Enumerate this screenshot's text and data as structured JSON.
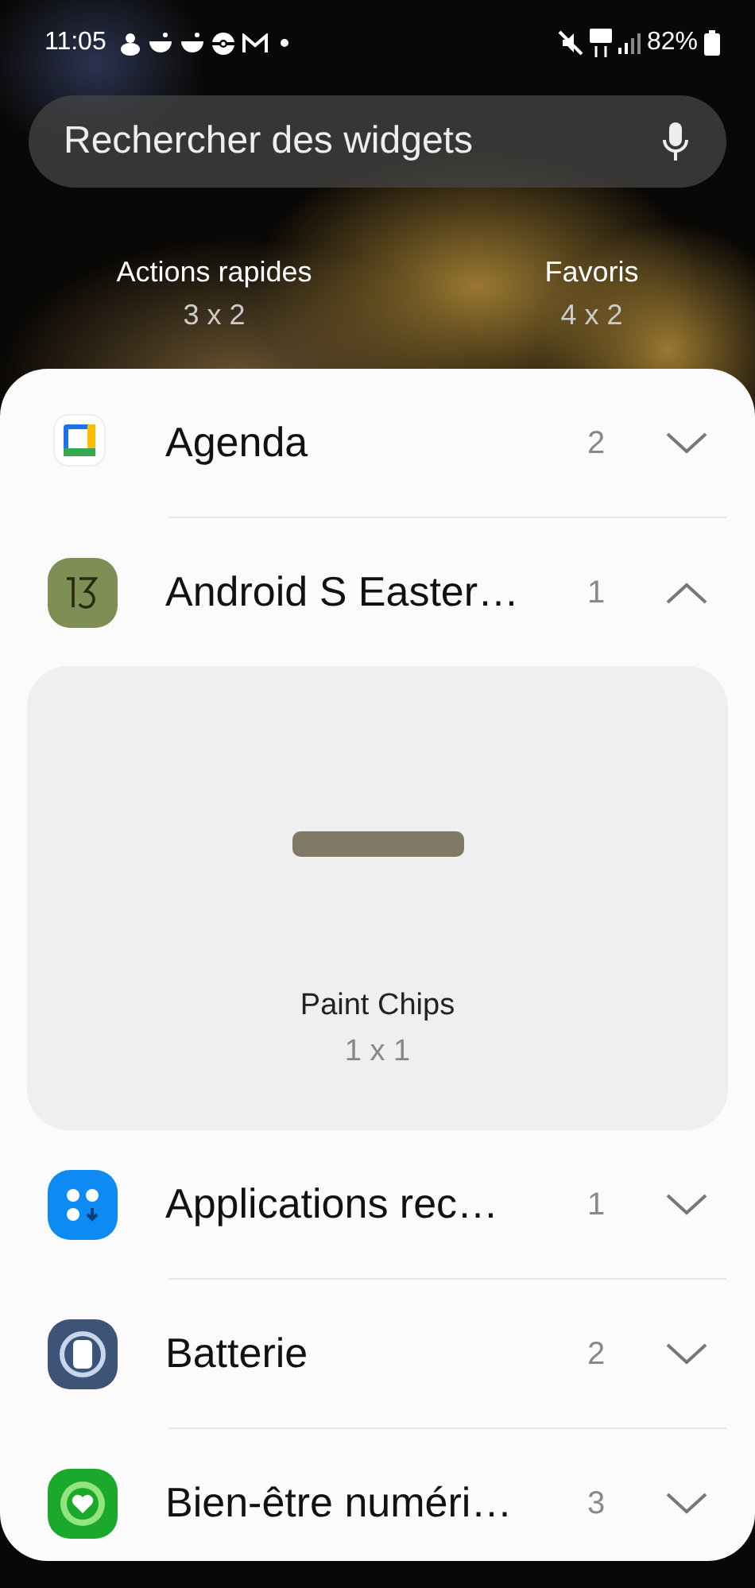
{
  "status_bar": {
    "time": "11:05",
    "battery": "82%"
  },
  "search": {
    "placeholder": "Rechercher des widgets"
  },
  "suggested": [
    {
      "name": "Actions rapides",
      "size": "3 x 2"
    },
    {
      "name": "Favoris",
      "size": "4 x 2"
    }
  ],
  "apps": [
    {
      "name": "Agenda",
      "count": "2",
      "expanded": false
    },
    {
      "name": "Android S Easter…",
      "count": "1",
      "expanded": true,
      "widgets": [
        {
          "name": "Paint Chips",
          "size": "1 x 1"
        }
      ]
    },
    {
      "name": "Applications rec…",
      "count": "1",
      "expanded": false
    },
    {
      "name": "Batterie",
      "count": "2",
      "expanded": false
    },
    {
      "name": "Bien-être numéri…",
      "count": "3",
      "expanded": false
    }
  ]
}
